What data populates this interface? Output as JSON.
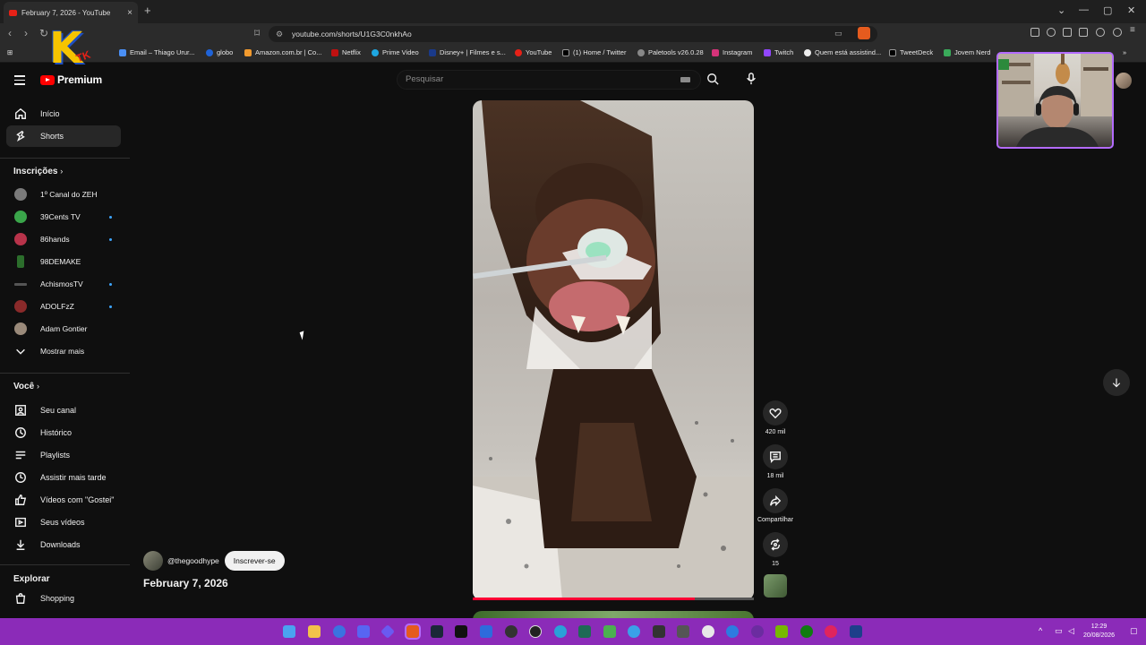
{
  "browser": {
    "tab_title": "February 7, 2026 - YouTube",
    "url": "youtube.com/shorts/U1G3C0nkhAo",
    "bookmarks": [
      "Email – Thiago Urur...",
      "globo",
      "Amazon.com.br | Co...",
      "Netflix",
      "Prime Video",
      "Disney+ | Filmes e s...",
      "YouTube",
      "(1) Home / Twitter",
      "Paletools v26.0.28",
      "Instagram",
      "Twitch",
      "Quem está assistind...",
      "TweetDeck",
      "Jovem Nerd"
    ]
  },
  "youtube": {
    "logo_text": "Premium",
    "logo_region": "BR",
    "search_placeholder": "Pesquisar",
    "nav": [
      {
        "label": "Início",
        "icon": "home-icon"
      },
      {
        "label": "Shorts",
        "icon": "shorts-icon"
      }
    ],
    "subscriptions_heading": "Inscrições",
    "subscriptions": [
      {
        "label": "1º Canal do ZEH",
        "dot": false
      },
      {
        "label": "39Cents TV",
        "dot": true
      },
      {
        "label": "86hands",
        "dot": true
      },
      {
        "label": "98DEMAKE",
        "dot": false
      },
      {
        "label": "AchismosTV",
        "dot": true
      },
      {
        "label": "ADOLFzZ",
        "dot": true
      },
      {
        "label": "Adam Gontier",
        "dot": false
      }
    ],
    "show_more": "Mostrar mais",
    "you_heading": "Você",
    "you_items": [
      {
        "label": "Seu canal",
        "icon": "channel-icon"
      },
      {
        "label": "Histórico",
        "icon": "history-icon"
      },
      {
        "label": "Playlists",
        "icon": "playlists-icon"
      },
      {
        "label": "Assistir mais tarde",
        "icon": "watch-later-icon"
      },
      {
        "label": "Vídeos com \"Gostei\"",
        "icon": "like-icon"
      },
      {
        "label": "Seus vídeos",
        "icon": "your-videos-icon"
      },
      {
        "label": "Downloads",
        "icon": "download-icon"
      }
    ],
    "explore_heading": "Explorar",
    "explore_items": [
      {
        "label": "Shopping",
        "icon": "shopping-icon"
      }
    ],
    "short": {
      "channel": "@thegoodhype",
      "subscribe_label": "Inscrever-se",
      "title": "February 7, 2026",
      "likes": "420 mil",
      "comments": "18 mil",
      "share_label": "Compartilhar",
      "remix_count": "15",
      "progress": 0.79
    }
  },
  "taskbar": {
    "time": "12:29",
    "date": "20/08/2026"
  },
  "colors": {
    "accent": "#ff0000",
    "taskbar": "#8b2bb8",
    "background": "#0f0f0f"
  }
}
